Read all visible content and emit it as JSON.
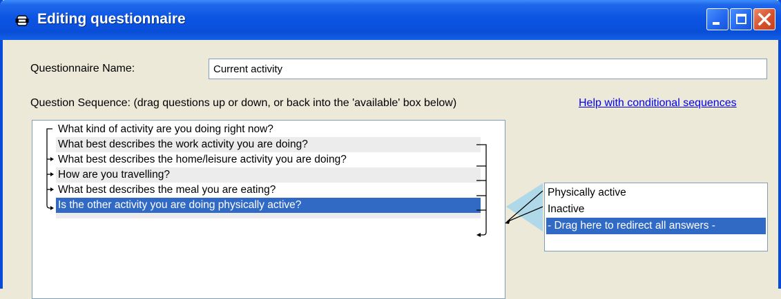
{
  "window": {
    "title": "Editing questionnaire"
  },
  "form": {
    "name_label": "Questionnaire Name:",
    "name_value": "Current activity",
    "sequence_label": "Question Sequence: (drag questions up or down, or back into the 'available' box below)",
    "help_link": "Help with conditional sequences"
  },
  "questions": [
    "What kind of activity are you doing right now?",
    "What best describes the work activity you are doing?",
    "What best describes the home/leisure activity you are doing?",
    "How are you travelling?",
    "What best describes the meal you are eating?",
    "Is the other activity you are doing physically active?"
  ],
  "answers": [
    "Physically active",
    "Inactive",
    "- Drag here to redirect all answers -"
  ],
  "colors": {
    "selection": "#316ac5",
    "titlebar": "#0a4ed8",
    "link": "#0000ee"
  }
}
